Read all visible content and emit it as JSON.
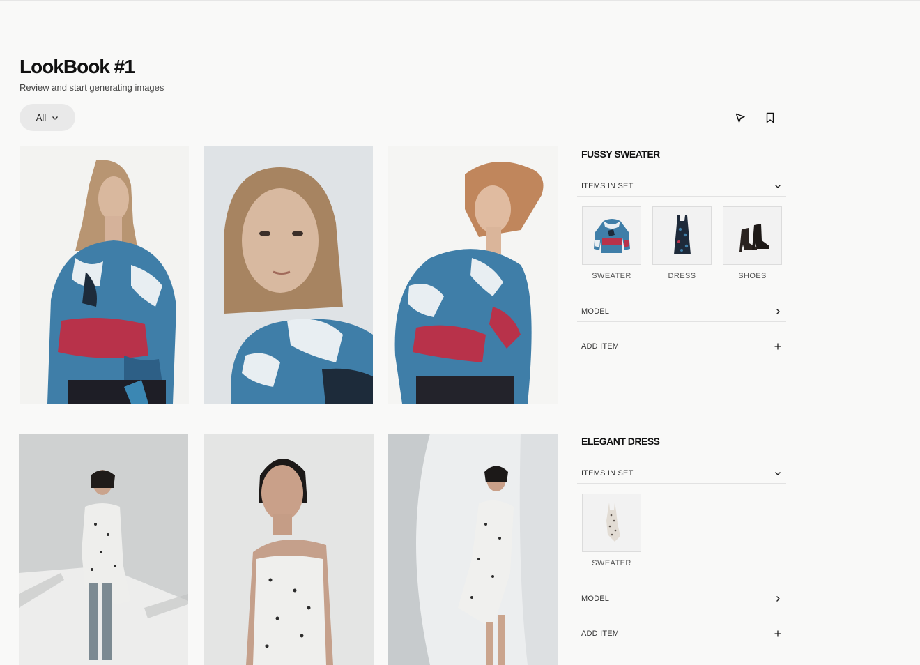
{
  "page": {
    "title": "LookBook #1",
    "subtitle": "Review and start generating images"
  },
  "filter": {
    "label": "All"
  },
  "toolbar": {
    "icons": [
      "pointer-icon",
      "bookmark-icon"
    ]
  },
  "sets": [
    {
      "title": "FUSSY SWEATER",
      "items_label": "ITEMS IN SET",
      "items": [
        {
          "label": "SWEATER",
          "icon": "sweater-icon"
        },
        {
          "label": "DRESS",
          "icon": "dress-icon"
        },
        {
          "label": "SHOES",
          "icon": "boots-icon"
        }
      ],
      "model_label": "MODEL",
      "add_label": "ADD ITEM"
    },
    {
      "title": "ELEGANT DRESS",
      "items_label": "ITEMS IN SET",
      "items": [
        {
          "label": "SWEATER",
          "icon": "slip-dress-icon"
        }
      ],
      "model_label": "MODEL",
      "add_label": "ADD ITEM"
    }
  ],
  "colors": {
    "background": "#f9f9f8",
    "fur_blue": "#3f7ea8",
    "fur_red": "#b8324a",
    "fur_white": "#e8eef2",
    "dress_print": "#2b2b2b"
  }
}
